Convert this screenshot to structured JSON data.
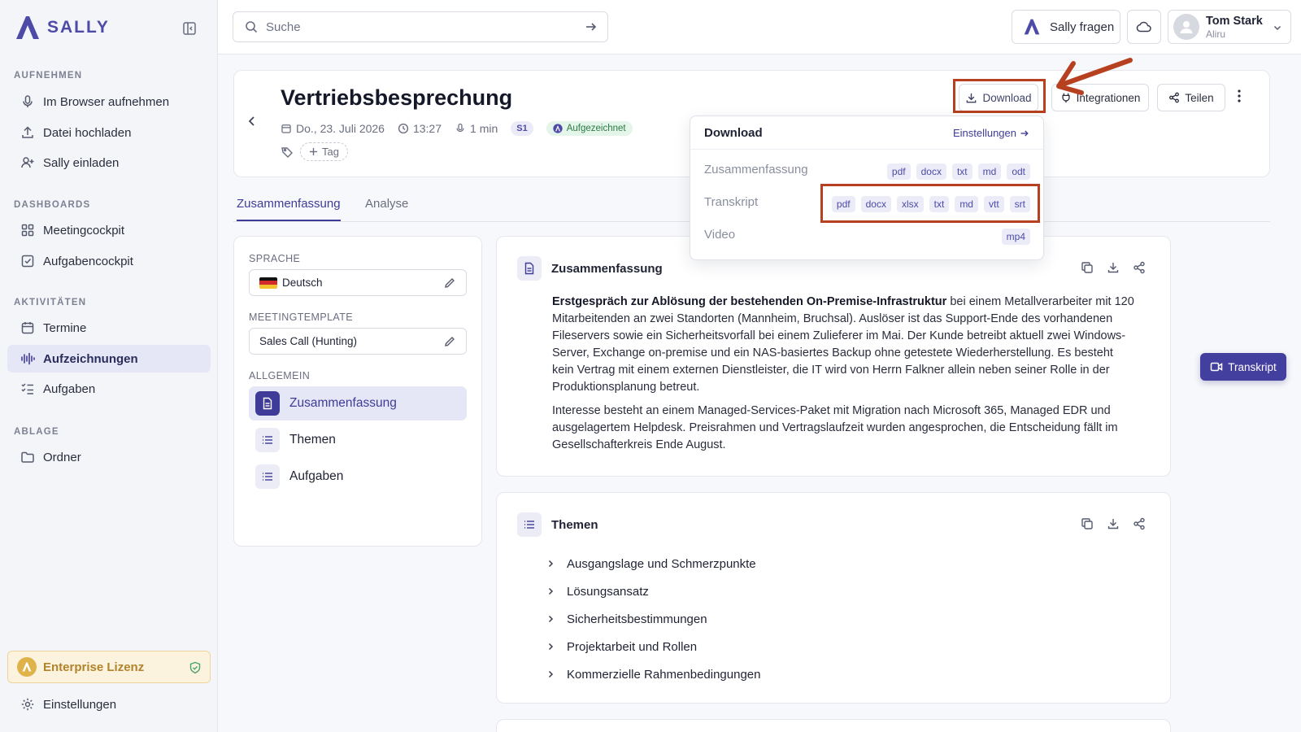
{
  "brand": {
    "name": "SALLY"
  },
  "sidebar": {
    "sections": [
      {
        "title": "AUFNEHMEN",
        "items": [
          {
            "label": "Im Browser aufnehmen",
            "icon": "microphone-icon"
          },
          {
            "label": "Datei hochladen",
            "icon": "upload-icon"
          },
          {
            "label": "Sally einladen",
            "icon": "user-plus-icon"
          }
        ]
      },
      {
        "title": "DASHBOARDS",
        "items": [
          {
            "label": "Meetingcockpit",
            "icon": "grid-icon"
          },
          {
            "label": "Aufgabencockpit",
            "icon": "checkbox-icon"
          }
        ]
      },
      {
        "title": "AKTIVITÄTEN",
        "items": [
          {
            "label": "Termine",
            "icon": "calendar-icon"
          },
          {
            "label": "Aufzeichnungen",
            "icon": "waveform-icon",
            "active": true
          },
          {
            "label": "Aufgaben",
            "icon": "tasklist-icon"
          }
        ]
      },
      {
        "title": "ABLAGE",
        "items": [
          {
            "label": "Ordner",
            "icon": "folder-icon"
          }
        ]
      }
    ],
    "license": "Enterprise Lizenz",
    "settings": "Einstellungen"
  },
  "topbar": {
    "search_placeholder": "Suche",
    "ask_sally": "Sally fragen",
    "user_name": "Tom Stark",
    "user_org": "Aliru"
  },
  "meeting": {
    "title": "Vertriebsbesprechung",
    "date": "Do., 23. Juli 2026",
    "time": "13:27",
    "duration": "1 min",
    "speaker_badge": "S1",
    "status": "Aufgezeichnet",
    "tag_label": "Tag",
    "actions": {
      "download": "Download",
      "integrations": "Integrationen",
      "share": "Teilen"
    }
  },
  "tabs": [
    "Zusammenfassung",
    "Analyse"
  ],
  "left_panel": {
    "language_label": "SPRACHE",
    "language_value": "Deutsch",
    "template_label": "MEETINGTEMPLATE",
    "template_value": "Sales Call (Hunting)",
    "general_label": "ALLGEMEIN",
    "items": [
      "Zusammenfassung",
      "Themen",
      "Aufgaben"
    ]
  },
  "summary": {
    "title": "Zusammenfassung",
    "p1_bold": "Erstgespräch zur Ablösung der bestehenden On-Premise-Infrastruktur",
    "p1_rest": " bei einem Metallverarbeiter mit 120 Mitarbeitenden an zwei Standorten (Mannheim, Bruchsal). Auslöser ist das Support-Ende des vorhandenen Fileservers sowie ein Sicherheitsvorfall bei einem Zulieferer im Mai. Der Kunde betreibt aktuell zwei Windows-Server, Exchange on-premise und ein NAS-basiertes Backup ohne getestete Wiederherstellung. Es besteht kein Vertrag mit einem externen Dienstleister, die IT wird von Herrn Falkner allein neben seiner Rolle in der Produktionsplanung betreut.",
    "p2": "Interesse besteht an einem Managed-Services-Paket mit Migration nach Microsoft 365, Managed EDR und ausgelagertem Helpdesk. Preisrahmen und Vertragslaufzeit wurden angesprochen, die Entscheidung fällt im Gesellschafterkreis Ende August."
  },
  "topics": {
    "title": "Themen",
    "items": [
      "Ausgangslage und Schmerzpunkte",
      "Lösungsansatz",
      "Sicherheitsbestimmungen",
      "Projektarbeit und Rollen",
      "Kommerzielle Rahmenbedingungen"
    ]
  },
  "download_menu": {
    "title": "Download",
    "settings_link": "Einstellungen",
    "rows": [
      {
        "label": "Zusammenfassung",
        "formats": [
          "pdf",
          "docx",
          "txt",
          "md",
          "odt"
        ]
      },
      {
        "label": "Transkript",
        "formats": [
          "pdf",
          "docx",
          "xlsx",
          "txt",
          "md",
          "vtt",
          "srt"
        ]
      },
      {
        "label": "Video",
        "formats": [
          "mp4"
        ]
      }
    ]
  },
  "floating_button": "Transkript",
  "colors": {
    "accent": "#3f3b99",
    "highlight": "#b6401f",
    "license": "#b1832a"
  }
}
